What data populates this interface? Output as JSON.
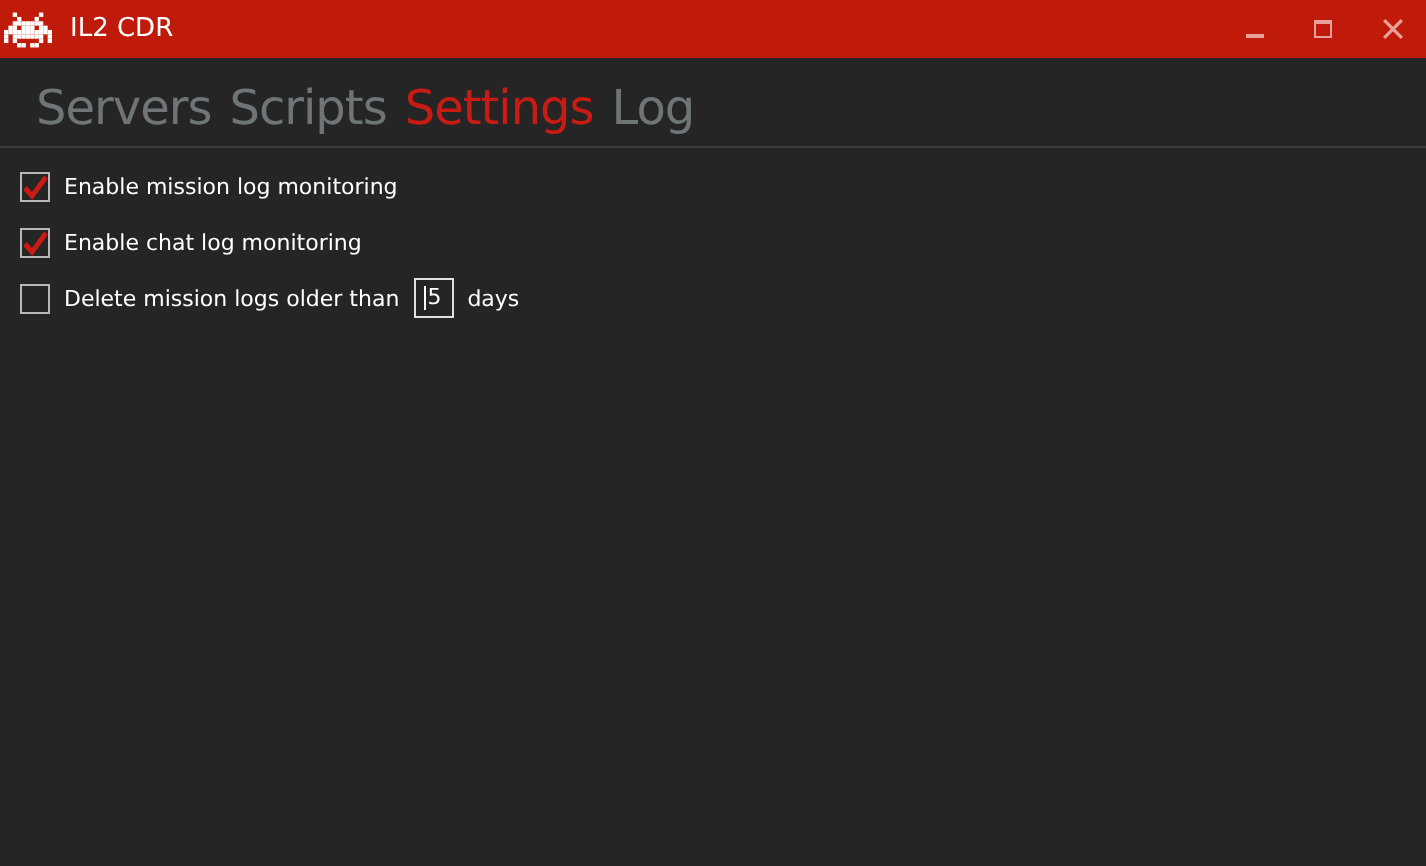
{
  "window": {
    "title": "IL2 CDR"
  },
  "tabs": [
    {
      "label": "Servers",
      "selected": false
    },
    {
      "label": "Scripts",
      "selected": false
    },
    {
      "label": "Settings",
      "selected": true
    },
    {
      "label": "Log",
      "selected": false
    }
  ],
  "options": [
    {
      "kind": "checkbox",
      "label": "Enable mission log monitoring",
      "checked": true
    },
    {
      "kind": "checkbox",
      "label": "Enable chat log monitoring",
      "checked": true
    },
    {
      "kind": "number",
      "label": "Delete mission logs older than",
      "checked": false,
      "value": "5",
      "unit": "days"
    }
  ]
}
